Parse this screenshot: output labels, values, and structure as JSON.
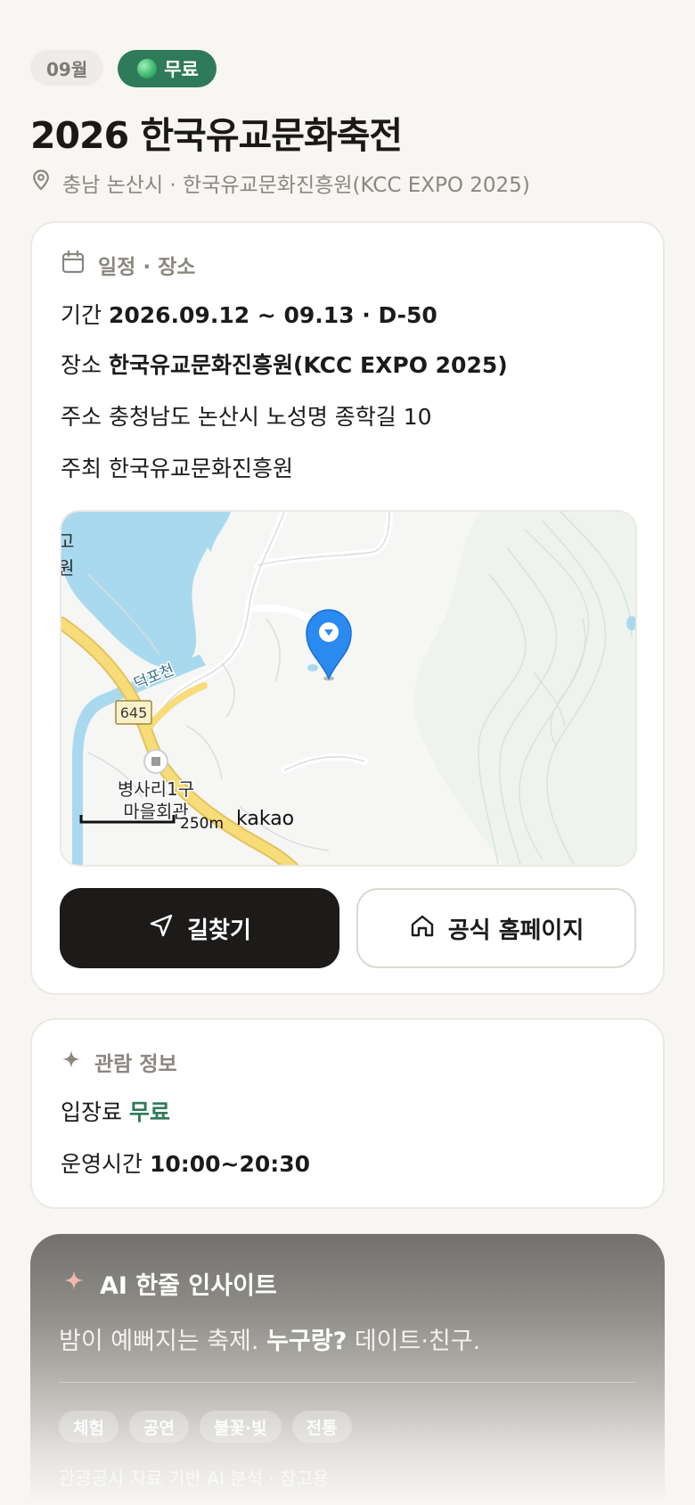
{
  "header": {
    "month_badge": "09월",
    "free_badge": "무료",
    "title": "2026 한국유교문화축전",
    "location": "충남 논산시 · 한국유교문화진흥원(KCC EXPO 2025)"
  },
  "schedule": {
    "section_title": "일정 · 장소",
    "period_key": "기간",
    "period_value": "2026.09.12 ~ 09.13 · D-50",
    "place_key": "장소",
    "place_value": "한국유교문화진흥원(KCC EXPO 2025)",
    "address_key": "주소",
    "address_value": "충청남도 논산시 노성명 종학길 10",
    "host_key": "주최",
    "host_value": "한국유교문화진흥원"
  },
  "map": {
    "label_stream": "덕포천",
    "label_road": "645",
    "label_village_line1": "병사리1구",
    "label_village_line2": "마을회관",
    "label_edge_1": "고",
    "label_edge_2": "원",
    "scale_text": "250m",
    "provider": "kakao"
  },
  "actions": {
    "directions_label": "길찾기",
    "homepage_label": "공식 홈페이지"
  },
  "visit": {
    "section_title": "관람 정보",
    "fee_key": "입장료",
    "fee_value": "무료",
    "hours_key": "운영시간",
    "hours_value": "10:00~20:30"
  },
  "ai": {
    "title": "AI 한줄 인사이트",
    "text_pre": "밤이 예뻐지는 축제. ",
    "text_bold": "누구랑?",
    "text_post": " 데이트·친구.",
    "tags": [
      "체험",
      "공연",
      "불꽃·빛",
      "전통"
    ],
    "note": "관광공사 자료 기반 AI 분석 · 참고용"
  },
  "colors": {
    "accent_green": "#2f7a58",
    "dark_button": "#1c1b19",
    "map_water": "#a9d9ee",
    "map_road": "#f7dc7a"
  }
}
